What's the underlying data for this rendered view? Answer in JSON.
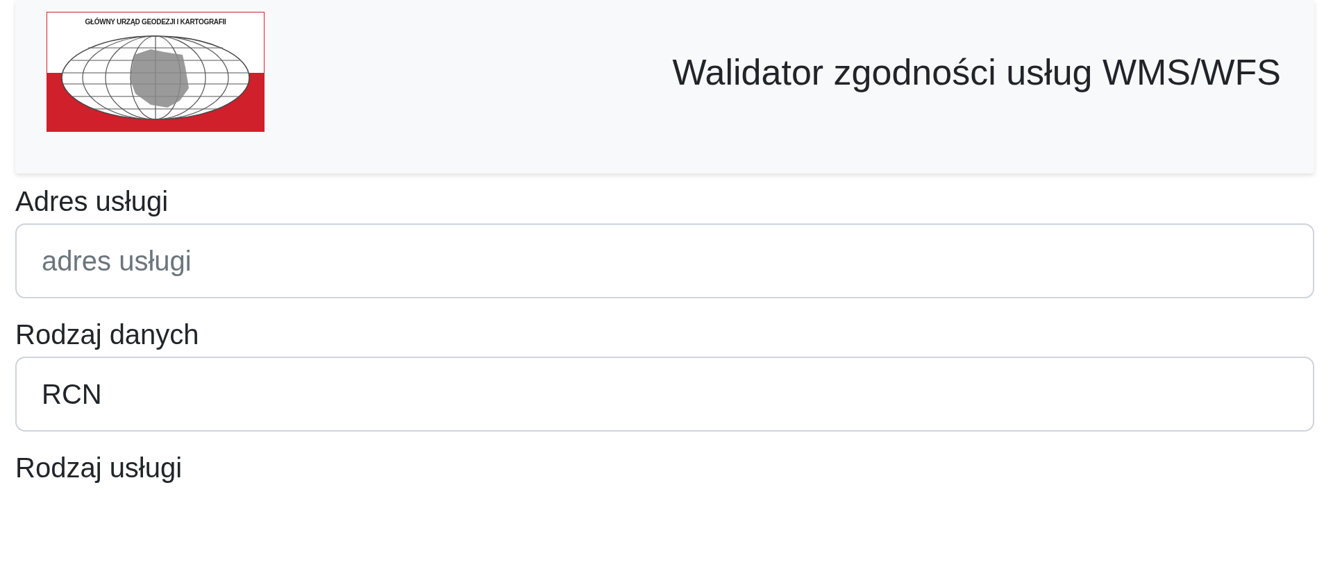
{
  "header": {
    "logo": {
      "text": "GŁÓWNY URZĄD GEODEZJI I KARTOGRAFII"
    },
    "title": "Walidator zgodności usług WMS/WFS"
  },
  "fields": [
    {
      "kind": "input",
      "label": "Adres usługi",
      "placeholder": "adres usługi"
    },
    {
      "kind": "select",
      "label": "Rodzaj danych",
      "value": "RCN"
    },
    {
      "kind": "label",
      "label": "Rodzaj usługi"
    }
  ]
}
